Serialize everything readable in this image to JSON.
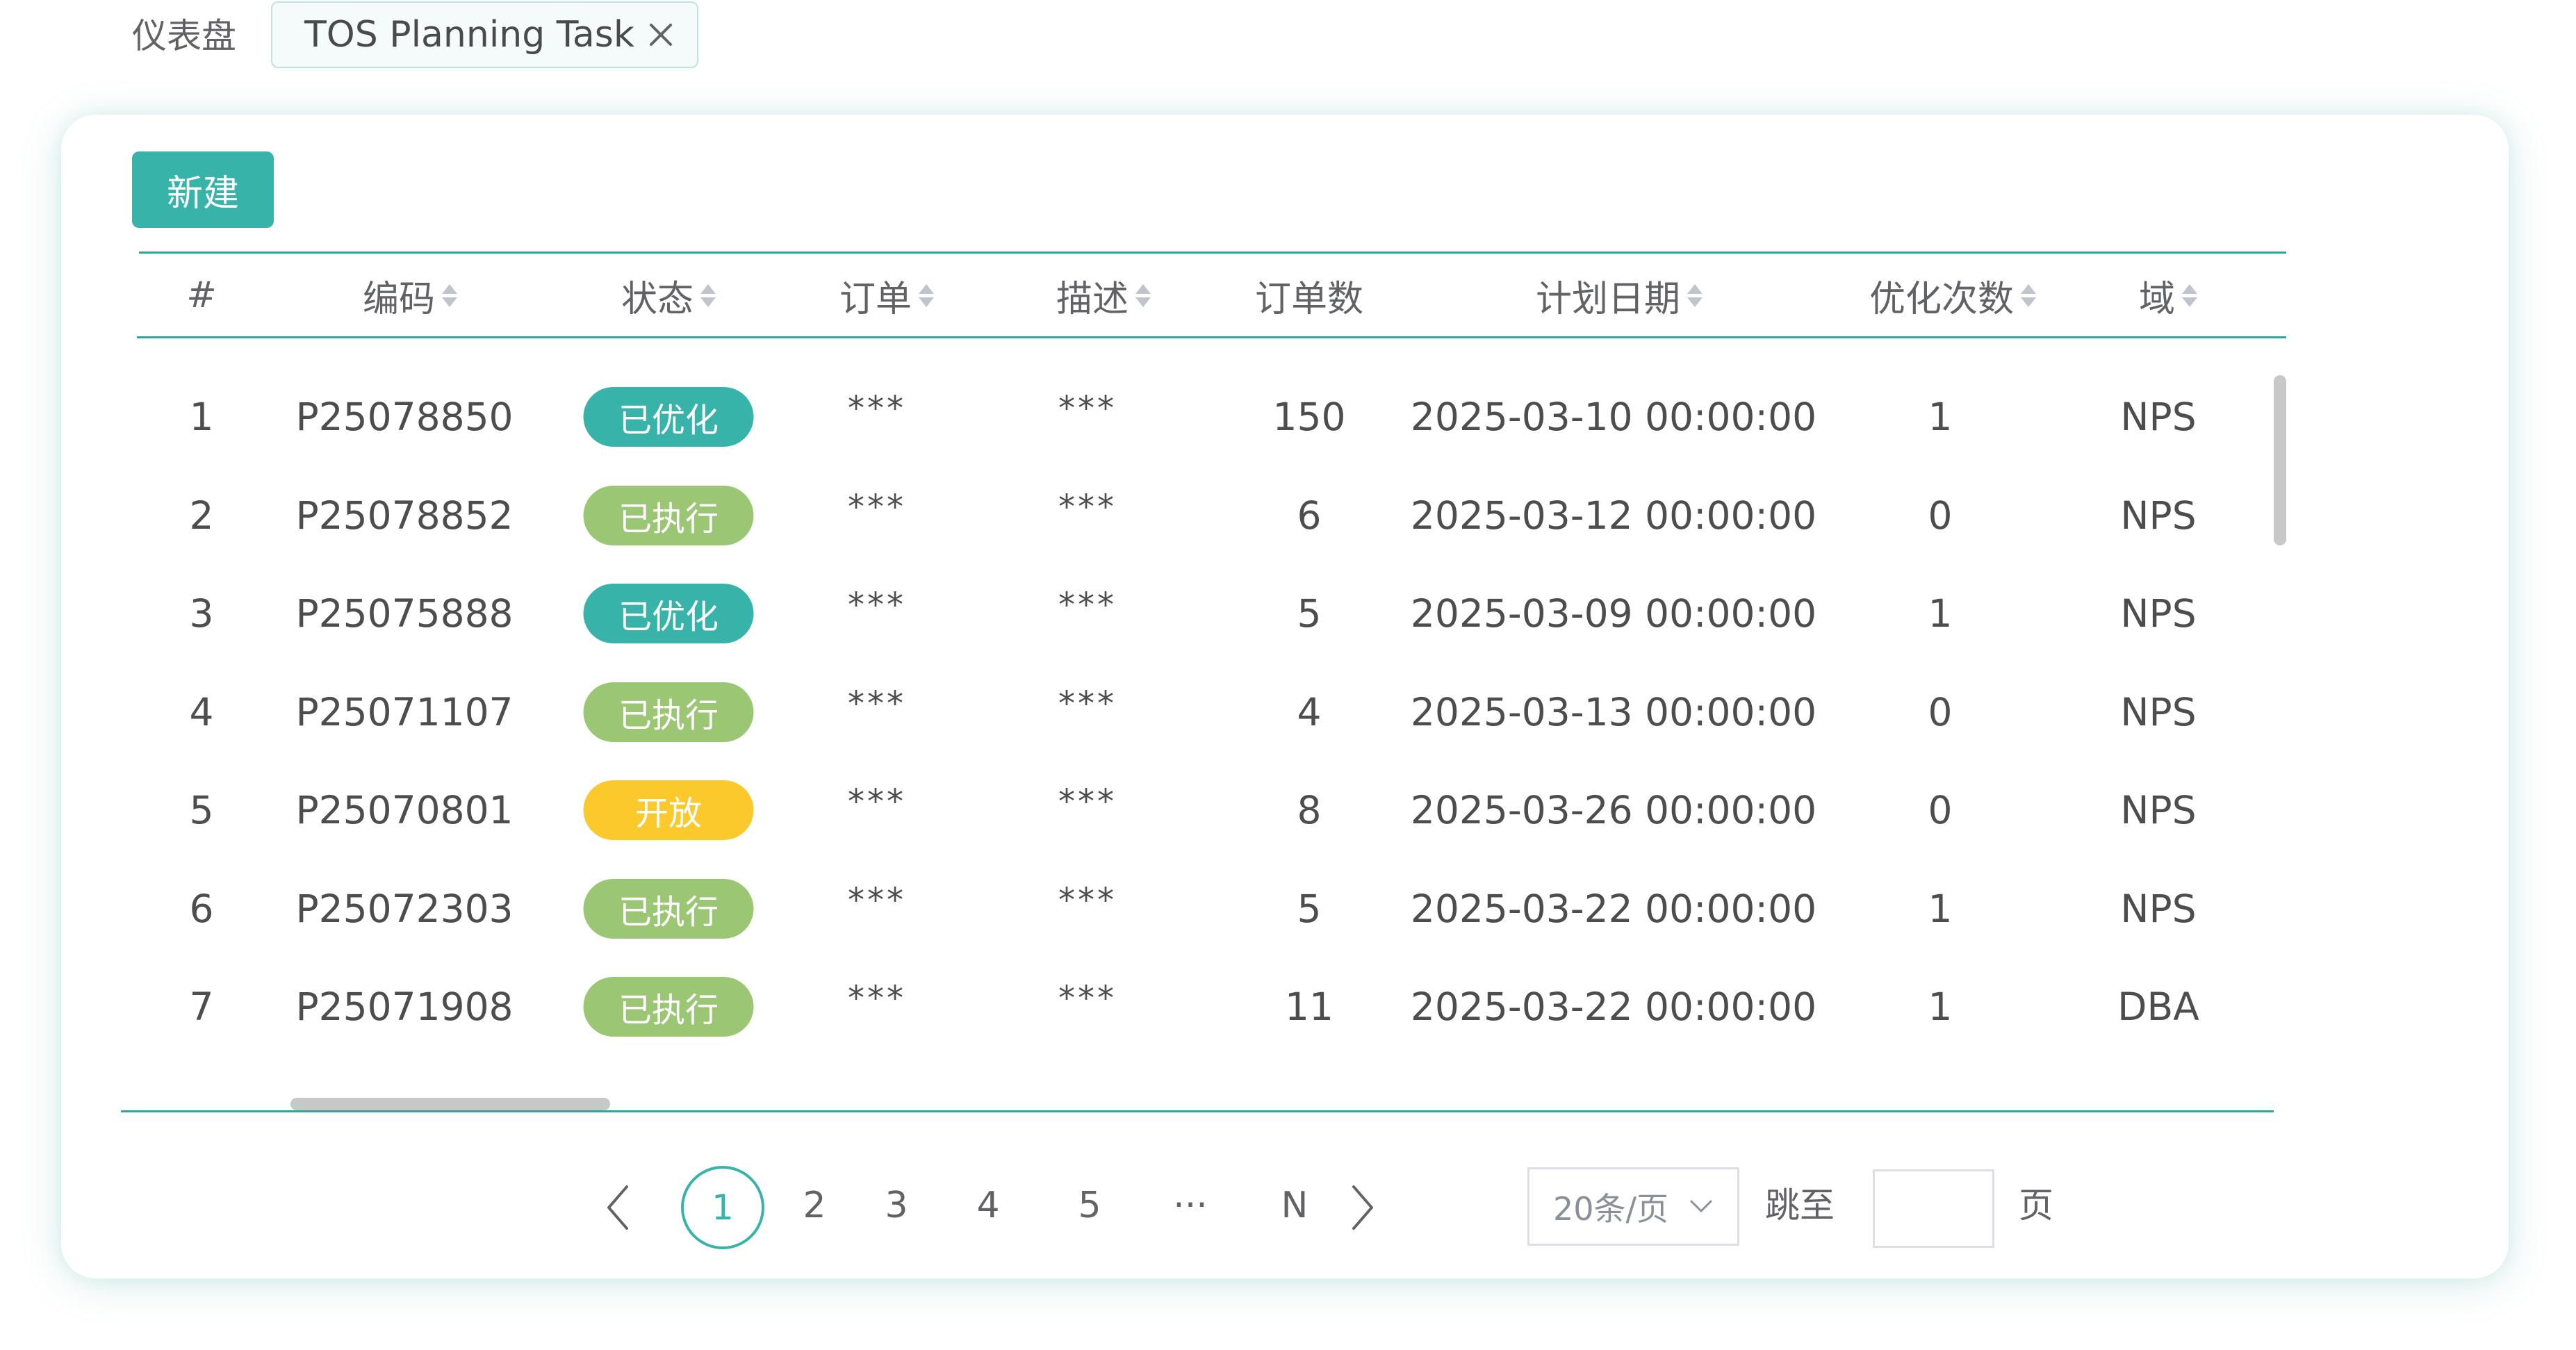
{
  "breadcrumb": "仪表盘",
  "tab": {
    "label": "TOS Planning Task"
  },
  "toolbar": {
    "new_label": "新建"
  },
  "columns": [
    {
      "label": "#",
      "sortable": false
    },
    {
      "label": "编码",
      "sortable": true
    },
    {
      "label": "状态",
      "sortable": true
    },
    {
      "label": "订单",
      "sortable": true
    },
    {
      "label": "描述",
      "sortable": true
    },
    {
      "label": "订单数",
      "sortable": false
    },
    {
      "label": "计划日期",
      "sortable": true
    },
    {
      "label": "优化次数",
      "sortable": true
    },
    {
      "label": "域",
      "sortable": true
    }
  ],
  "status_colors": {
    "已优化": "#37b3aa",
    "已执行": "#9bc774",
    "开放": "#fcc92c"
  },
  "rows": [
    {
      "index": "1",
      "code": "P25078850",
      "status": "已优化",
      "order": "***",
      "desc": "***",
      "order_count": "150",
      "plan_date": "2025-03-10 00:00:00",
      "opt_count": "1",
      "domain": "NPS"
    },
    {
      "index": "2",
      "code": "P25078852",
      "status": "已执行",
      "order": "***",
      "desc": "***",
      "order_count": "6",
      "plan_date": "2025-03-12 00:00:00",
      "opt_count": "0",
      "domain": "NPS"
    },
    {
      "index": "3",
      "code": "P25075888",
      "status": "已优化",
      "order": "***",
      "desc": "***",
      "order_count": "5",
      "plan_date": "2025-03-09 00:00:00",
      "opt_count": "1",
      "domain": "NPS"
    },
    {
      "index": "4",
      "code": "P25071107",
      "status": "已执行",
      "order": "***",
      "desc": "***",
      "order_count": "4",
      "plan_date": "2025-03-13 00:00:00",
      "opt_count": "0",
      "domain": "NPS"
    },
    {
      "index": "5",
      "code": "P25070801",
      "status": "开放",
      "order": "***",
      "desc": "***",
      "order_count": "8",
      "plan_date": "2025-03-26 00:00:00",
      "opt_count": "0",
      "domain": "NPS"
    },
    {
      "index": "6",
      "code": "P25072303",
      "status": "已执行",
      "order": "***",
      "desc": "***",
      "order_count": "5",
      "plan_date": "2025-03-22 00:00:00",
      "opt_count": "1",
      "domain": "NPS"
    },
    {
      "index": "7",
      "code": "P25071908",
      "status": "已执行",
      "order": "***",
      "desc": "***",
      "order_count": "11",
      "plan_date": "2025-03-22 00:00:00",
      "opt_count": "1",
      "domain": "DBA"
    }
  ],
  "pagination": {
    "current": "1",
    "pages": [
      "2",
      "3",
      "4",
      "5"
    ],
    "ellipsis": "···",
    "last": "N",
    "page_size": "20条/页",
    "jump_label": "跳至",
    "jump_value": "",
    "page_suffix": "页"
  }
}
